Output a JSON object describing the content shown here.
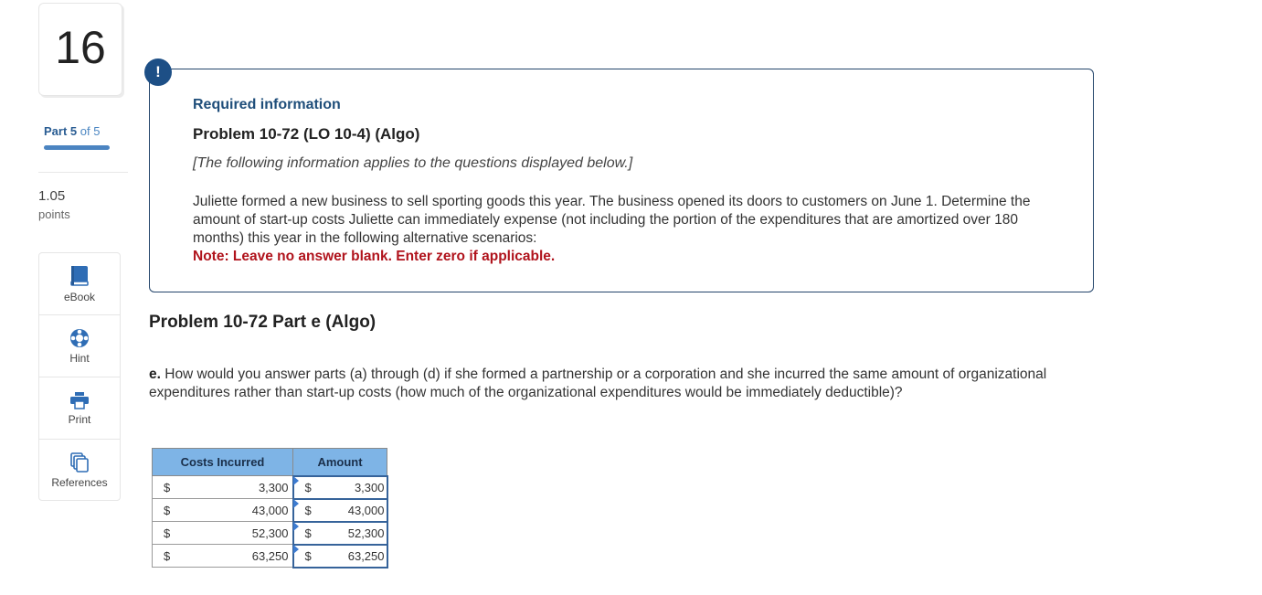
{
  "question": {
    "number": "16",
    "part_word": "Part",
    "part_current": "5",
    "part_of": "of 5",
    "progress_fraction": 1.0,
    "points_value": "1.05",
    "points_label": "points"
  },
  "tools": [
    {
      "label": "eBook",
      "icon": "book-icon"
    },
    {
      "label": "Hint",
      "icon": "lifebuoy-icon"
    },
    {
      "label": "Print",
      "icon": "printer-icon"
    },
    {
      "label": "References",
      "icon": "documents-icon"
    }
  ],
  "info": {
    "badge": "!",
    "required": "Required information",
    "problem_title": "Problem 10-72 (LO 10-4) (Algo)",
    "intro": "[The following information applies to the questions displayed below.]",
    "body": "Juliette formed a new business to sell sporting goods this year. The business opened its doors to customers on June 1. Determine the amount of start-up costs Juliette can immediately expense (not including the portion of the expenditures that are amortized over 180 months) this year in the following alternative scenarios:",
    "note": "Note: Leave no answer blank. Enter zero if applicable."
  },
  "part": {
    "title": "Problem 10-72 Part e (Algo)",
    "question_letter": "e.",
    "question_text": " How would you answer parts (a) through (d) if she formed a partnership or a corporation and she incurred the same amount of organizational expenditures rather than start-up costs (how much of the organizational expenditures would be immediately deductible)?"
  },
  "table": {
    "headers": [
      "Costs Incurred",
      "Amount"
    ],
    "rows": [
      {
        "currency": "$",
        "cost": "3,300",
        "amount_currency": "$",
        "amount": "3,300"
      },
      {
        "currency": "$",
        "cost": "43,000",
        "amount_currency": "$",
        "amount": "43,000"
      },
      {
        "currency": "$",
        "cost": "52,300",
        "amount_currency": "$",
        "amount": "52,300"
      },
      {
        "currency": "$",
        "cost": "63,250",
        "amount_currency": "$",
        "amount": "63,250"
      }
    ]
  }
}
